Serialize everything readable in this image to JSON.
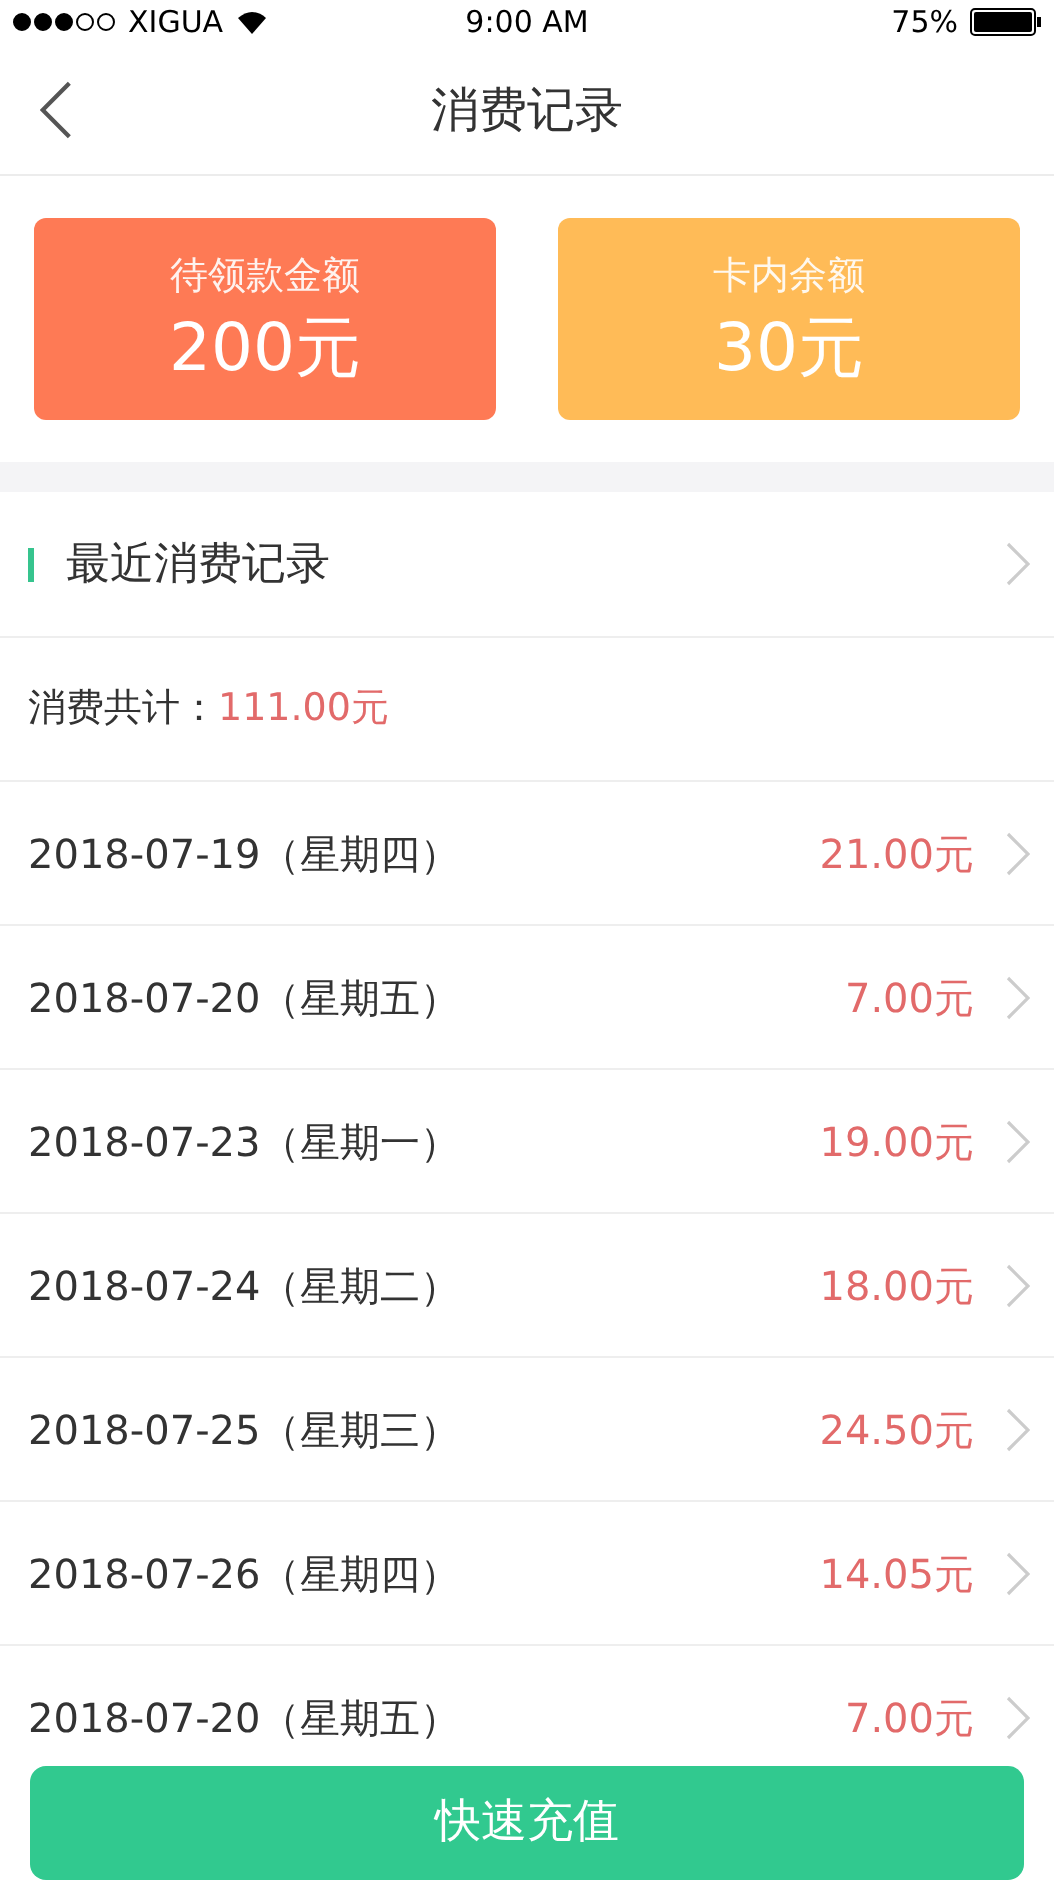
{
  "status_bar": {
    "carrier": "XIGUA",
    "time": "9:00 AM",
    "battery": "75%"
  },
  "nav": {
    "title": "消费记录"
  },
  "cards": [
    {
      "label": "待领款金额",
      "amount": "200元",
      "color": "#fe7a55"
    },
    {
      "label": "卡内余额",
      "amount": "30元",
      "color": "#ffbb57"
    }
  ],
  "section": {
    "title": "最近消费记录"
  },
  "total": {
    "label": "消费共计：",
    "amount": "111.00元"
  },
  "records": [
    {
      "date": "2018-07-19（星期四）",
      "amount": "21.00元"
    },
    {
      "date": "2018-07-20（星期五）",
      "amount": "7.00元"
    },
    {
      "date": "2018-07-23（星期一）",
      "amount": "19.00元"
    },
    {
      "date": "2018-07-24（星期二）",
      "amount": "18.00元"
    },
    {
      "date": "2018-07-25（星期三）",
      "amount": "24.50元"
    },
    {
      "date": "2018-07-26（星期四）",
      "amount": "14.05元"
    },
    {
      "date": "2018-07-20（星期五）",
      "amount": "7.00元"
    }
  ],
  "button": {
    "label": "快速充值"
  }
}
